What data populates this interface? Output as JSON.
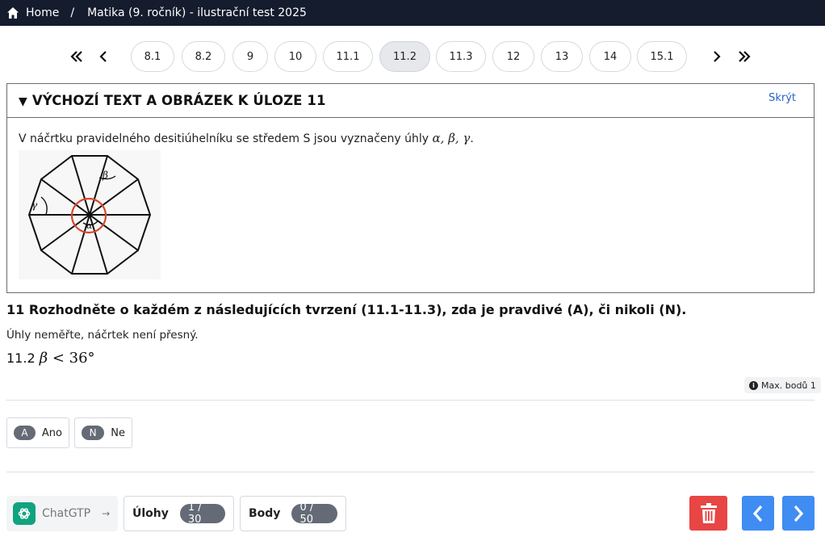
{
  "breadcrumb": {
    "home_label": "Home",
    "separator": "/",
    "current": "Matika (9. ročník) - ilustrační test 2025"
  },
  "pager": {
    "first_icon": "double-chevron-left-icon",
    "prev_icon": "chevron-left-icon",
    "next_icon": "chevron-right-icon",
    "last_icon": "double-chevron-right-icon",
    "pages": [
      "8.1",
      "8.2",
      "9",
      "10",
      "11.1",
      "11.2",
      "11.3",
      "12",
      "13",
      "14",
      "15.1"
    ],
    "active": "11.2"
  },
  "panel": {
    "title": "VÝCHOZÍ TEXT A OBRÁZEK K ÚLOZE 11",
    "hide_label": "Skrýt",
    "text_prefix": "V náčrtku pravidelného desitiúhelníku se středem S jsou vyznačeny úhly ",
    "text_angles": "α, β, γ",
    "text_suffix": ".",
    "figure_labels": {
      "alpha": "α",
      "beta": "β",
      "gamma": "γ"
    }
  },
  "question": {
    "title": "11 Rozhodněte o každém z následujících tvrzení (11.1-11.3), zda je pravdivé (A), či nikoli (N).",
    "note": "Úhly neměřte, náčrtek není přesný.",
    "item_number": "11.2",
    "item_var": "β",
    "item_rel": " < 36°",
    "max_points": "Max. bodů 1"
  },
  "answers": [
    {
      "key": "A",
      "label": "Ano"
    },
    {
      "key": "N",
      "label": "Ne"
    }
  ],
  "bottom": {
    "chat_label": "ChatGTP",
    "chat_arrow": "→",
    "tasks_label": "Úlohy",
    "tasks_value": "1 / 30",
    "points_label": "Body",
    "points_value": "0 / 50"
  },
  "colors": {
    "topbar": "#141c2e",
    "link": "#2563c9",
    "delete": "#e84545",
    "nav": "#3f8cf3",
    "chat_logo": "#10a37f",
    "circle": "#d9472b"
  }
}
